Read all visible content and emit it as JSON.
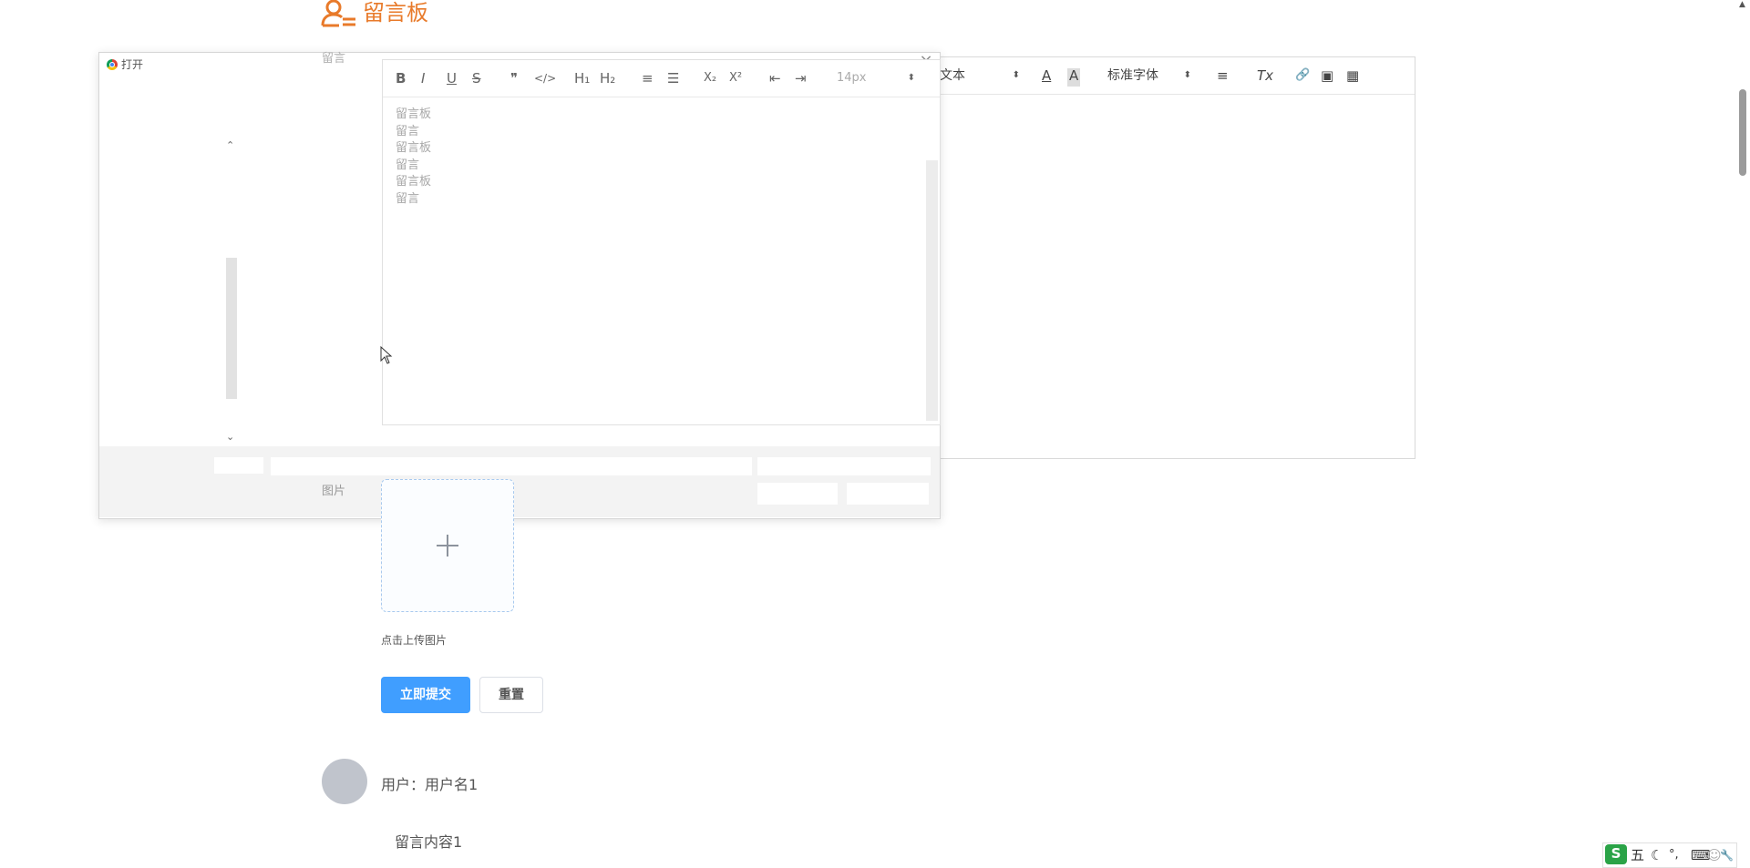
{
  "header": {
    "title": "留言板",
    "icon": "user-message-icon",
    "accent": "#e87a2a"
  },
  "form": {
    "message_label": "留言",
    "image_label": "图片",
    "upload_hint": "点击上传图片",
    "submit_label": "立即提交",
    "reset_label": "重置"
  },
  "editor": {
    "toolbar": {
      "bold": "B",
      "italic": "I",
      "underline": "U",
      "strike": "S",
      "quote": "❞",
      "code": "</>",
      "h1": "H₁",
      "h2": "H₂",
      "ordered_list": "≡",
      "bullet_list": "☰",
      "subscript": "X₂",
      "superscript": "X²",
      "outdent": "⇤",
      "indent": "⇥",
      "size": "14px",
      "format": "文本",
      "font_color": "A",
      "bg_color": "A",
      "font_family": "标准字体",
      "align": "≡",
      "clear": "Tx",
      "link": "🔗",
      "image": "▣",
      "video": "▦"
    }
  },
  "dialog": {
    "title": "打开",
    "close": "×",
    "content_lines": [
      "留言板",
      "留言",
      "留言板",
      "留言",
      "留言板",
      "留言"
    ]
  },
  "comments": [
    {
      "user": "用户：用户名1",
      "content": "留言内容1"
    }
  ],
  "ime": {
    "logo": "S",
    "mode": "五",
    "moon": "☾",
    "punct": "°,",
    "keyboard": "⌨",
    "user": "☺",
    "tool": "🔧"
  },
  "colors": {
    "primary": "#409eff",
    "accent": "#e87a2a"
  }
}
